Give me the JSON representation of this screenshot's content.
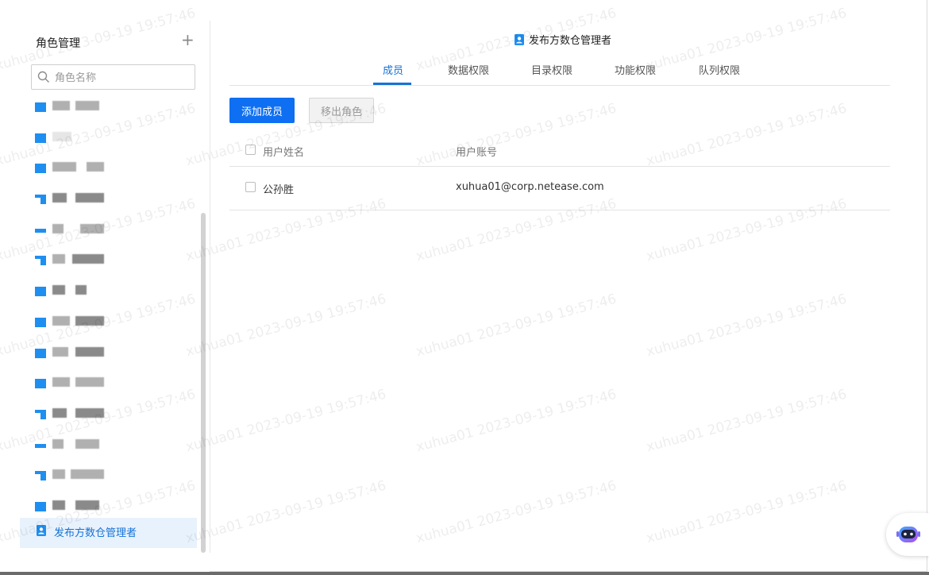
{
  "sidebar": {
    "title": "角色管理",
    "add_icon": "plus-icon",
    "search": {
      "placeholder": "角色名称",
      "value": ""
    },
    "selected_item": {
      "label": "发布方数仓管理者",
      "icon": "user-badge-icon"
    },
    "colors": {
      "accent": "#1e8ff0",
      "selected_bg": "#e8f2fc",
      "selected_text": "#1672d6"
    }
  },
  "main": {
    "role_title": "发布方数仓管理者",
    "tabs": [
      {
        "label": "成员",
        "active": true
      },
      {
        "label": "数据权限",
        "active": false
      },
      {
        "label": "目录权限",
        "active": false
      },
      {
        "label": "功能权限",
        "active": false
      },
      {
        "label": "队列权限",
        "active": false
      }
    ],
    "actions": {
      "add_member": "添加成员",
      "remove_role": "移出角色"
    },
    "table": {
      "columns": [
        "用户姓名",
        "用户账号"
      ],
      "rows": [
        {
          "name": "公孙胜",
          "account": "xuhua01@corp.netease.com"
        }
      ]
    },
    "colors": {
      "primary": "#0e6ff2",
      "link": "#1672d6"
    }
  },
  "watermark": {
    "text": "xuhua01 2023-09-19 19:57:46"
  },
  "assistant": {
    "icon": "robot-assistant-icon"
  }
}
